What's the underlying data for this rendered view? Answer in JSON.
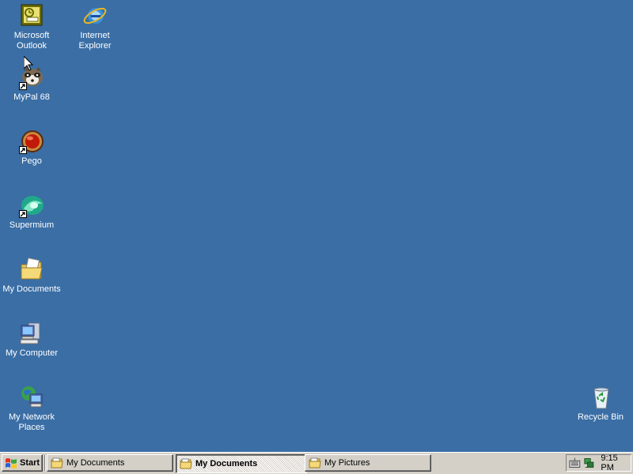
{
  "desktop": {
    "background_color": "#3a6ea5",
    "icons": [
      {
        "label": "Microsoft Outlook",
        "icon": "outlook-icon"
      },
      {
        "label": "Internet Explorer",
        "icon": "internet-explorer-icon"
      },
      {
        "label": "MyPal 68",
        "icon": "mypal-icon",
        "shortcut": true
      },
      {
        "label": "Pego",
        "icon": "pego-icon",
        "shortcut": true
      },
      {
        "label": "Supermium",
        "icon": "supermium-icon",
        "shortcut": true
      },
      {
        "label": "My Documents",
        "icon": "my-documents-icon"
      },
      {
        "label": "My Computer",
        "icon": "my-computer-icon"
      },
      {
        "label": "My Network Places",
        "icon": "my-network-places-icon"
      },
      {
        "label": "Recycle Bin",
        "icon": "recycle-bin-icon"
      }
    ]
  },
  "taskbar": {
    "start_label": "Start",
    "tasks": [
      {
        "label": "My Documents",
        "icon": "folder-icon",
        "active": false
      },
      {
        "label": "My Documents",
        "icon": "folder-icon",
        "active": true
      },
      {
        "label": "My Pictures",
        "icon": "folder-icon",
        "active": false
      }
    ],
    "tray": {
      "icons": [
        "keyboard-icon",
        "network-icon"
      ],
      "clock": "9:15 PM"
    }
  }
}
